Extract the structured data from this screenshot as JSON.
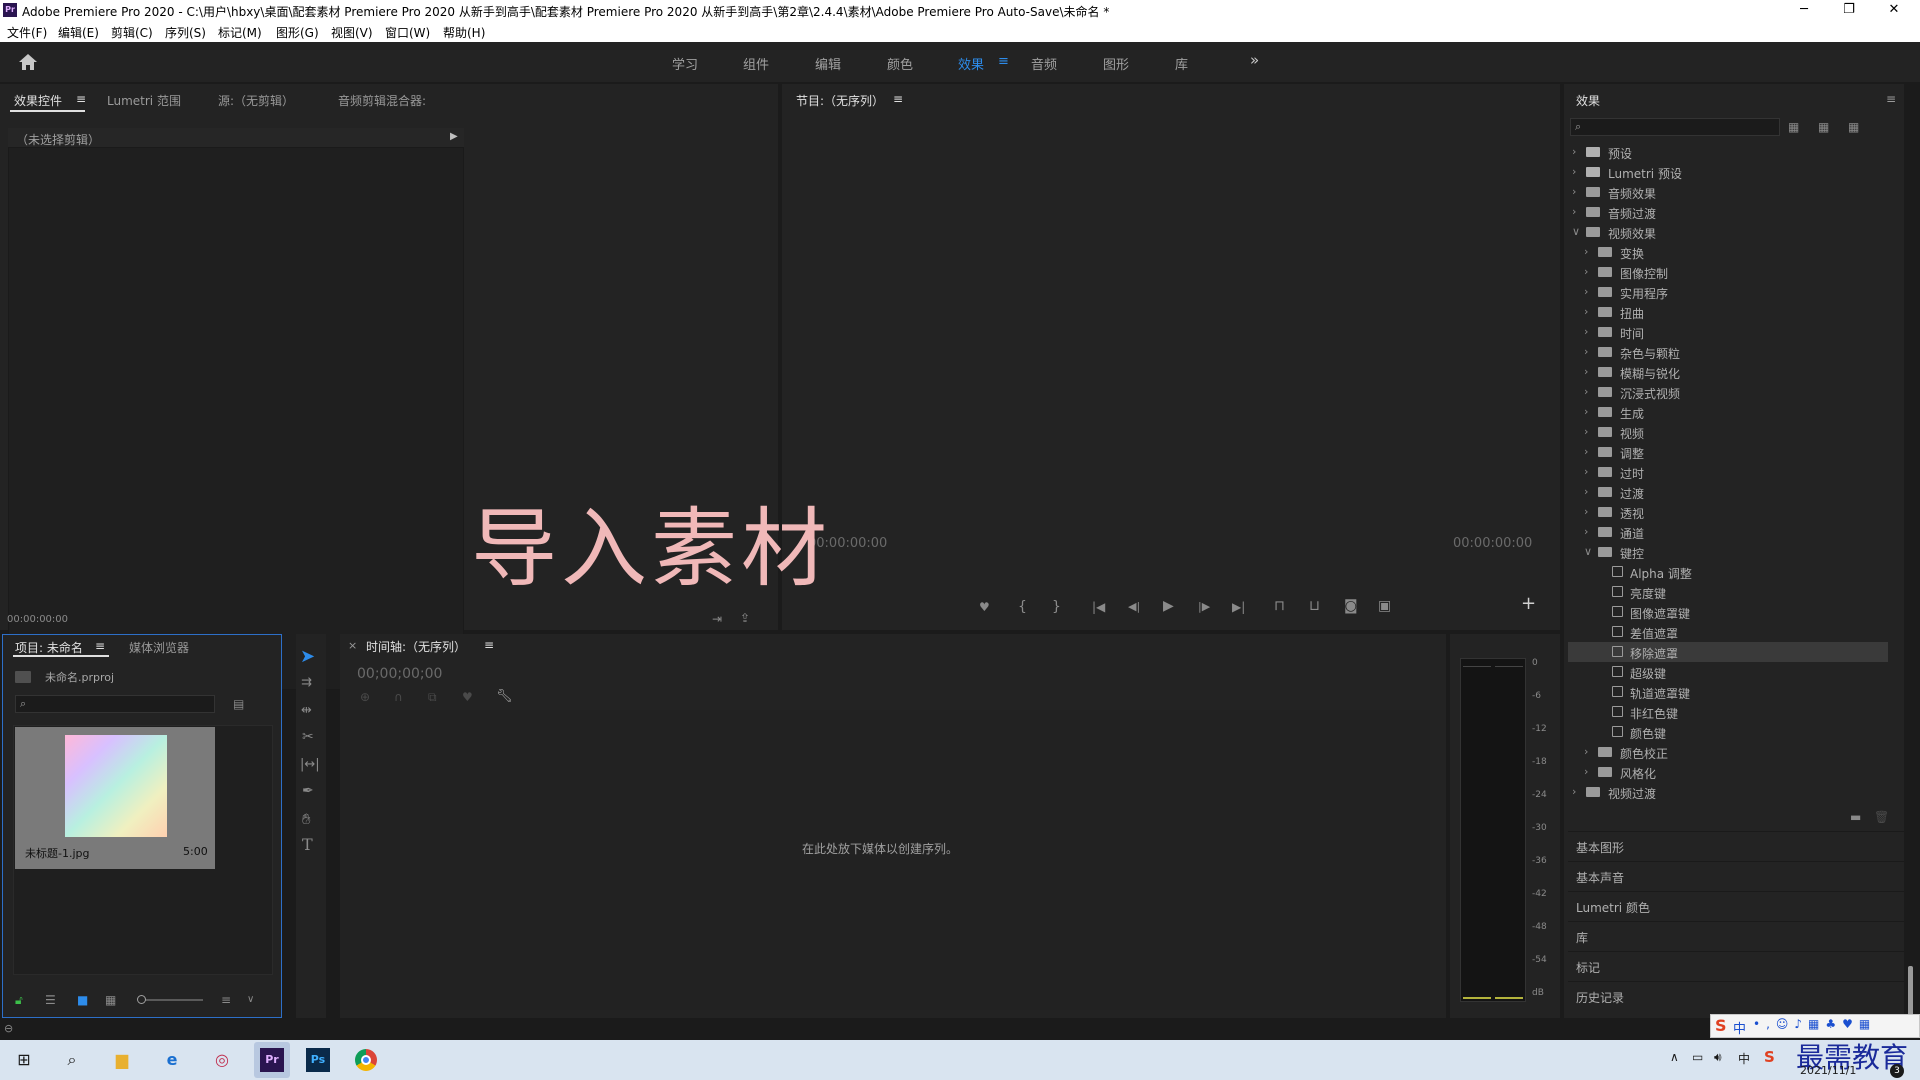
{
  "window": {
    "title": "Adobe Premiere Pro 2020 - C:\\用户\\hbxy\\桌面\\配套素材 Premiere Pro 2020 从新手到高手\\配套素材 Premiere Pro 2020 从新手到高手\\第2章\\2.4.4\\素材\\Adobe Premiere Pro Auto-Save\\未命名 *",
    "app_icon": "Pr",
    "controls": {
      "minimize": "─",
      "restore": "❐",
      "close": "✕"
    }
  },
  "menu": [
    "文件(F)",
    "编辑(E)",
    "剪辑(C)",
    "序列(S)",
    "标记(M)",
    "图形(G)",
    "视图(V)",
    "窗口(W)",
    "帮助(H)"
  ],
  "workspaces": {
    "items": [
      "学习",
      "组件",
      "编辑",
      "颜色",
      "效果",
      "音频",
      "图形",
      "库"
    ],
    "active": "效果",
    "more": "»"
  },
  "source_panel": {
    "tabs": [
      "效果控件",
      "Lumetri 范围",
      "源:（无剪辑）",
      "音频剪辑混合器:"
    ],
    "no_clip": "（未选择剪辑）",
    "timecode": "00:00:00:00"
  },
  "program_panel": {
    "title": "节目:（无序列）",
    "timecode_left": "00:00:00:00",
    "timecode_right": "00:00:00:00"
  },
  "overlay_caption": "导入素材",
  "project_panel": {
    "tabs": [
      "项目: 未命名",
      "媒体浏览器"
    ],
    "file": "未命名.prproj",
    "clip": {
      "name": "未标题-1.jpg",
      "duration": "5:00"
    }
  },
  "timeline_panel": {
    "title": "时间轴:（无序列）",
    "timecode": "00;00;00;00",
    "empty_text": "在此处放下媒体以创建序列。"
  },
  "audio_meter": {
    "scale": [
      "0",
      "-6",
      "-12",
      "-18",
      "-24",
      "-30",
      "-36",
      "-42",
      "-48",
      "-54",
      "dB"
    ]
  },
  "effects_panel": {
    "title": "效果",
    "tree": [
      {
        "label": "预设",
        "level": 0,
        "type": "folder-special",
        "open": false
      },
      {
        "label": "Lumetri 预设",
        "level": 0,
        "type": "folder-special",
        "open": false
      },
      {
        "label": "音频效果",
        "level": 0,
        "type": "folder",
        "open": false
      },
      {
        "label": "音频过渡",
        "level": 0,
        "type": "folder",
        "open": false
      },
      {
        "label": "视频效果",
        "level": 0,
        "type": "folder",
        "open": true
      },
      {
        "label": "变换",
        "level": 1,
        "type": "folder",
        "open": false
      },
      {
        "label": "图像控制",
        "level": 1,
        "type": "folder",
        "open": false
      },
      {
        "label": "实用程序",
        "level": 1,
        "type": "folder",
        "open": false
      },
      {
        "label": "扭曲",
        "level": 1,
        "type": "folder",
        "open": false
      },
      {
        "label": "时间",
        "level": 1,
        "type": "folder",
        "open": false
      },
      {
        "label": "杂色与颗粒",
        "level": 1,
        "type": "folder",
        "open": false
      },
      {
        "label": "模糊与锐化",
        "level": 1,
        "type": "folder",
        "open": false
      },
      {
        "label": "沉浸式视频",
        "level": 1,
        "type": "folder",
        "open": false
      },
      {
        "label": "生成",
        "level": 1,
        "type": "folder",
        "open": false
      },
      {
        "label": "视频",
        "level": 1,
        "type": "folder",
        "open": false
      },
      {
        "label": "调整",
        "level": 1,
        "type": "folder",
        "open": false
      },
      {
        "label": "过时",
        "level": 1,
        "type": "folder",
        "open": false
      },
      {
        "label": "过渡",
        "level": 1,
        "type": "folder",
        "open": false
      },
      {
        "label": "透视",
        "level": 1,
        "type": "folder",
        "open": false
      },
      {
        "label": "通道",
        "level": 1,
        "type": "folder",
        "open": false
      },
      {
        "label": "键控",
        "level": 1,
        "type": "folder",
        "open": true
      },
      {
        "label": "Alpha 调整",
        "level": 2,
        "type": "effect"
      },
      {
        "label": "亮度键",
        "level": 2,
        "type": "effect"
      },
      {
        "label": "图像遮罩键",
        "level": 2,
        "type": "effect"
      },
      {
        "label": "差值遮罩",
        "level": 2,
        "type": "effect"
      },
      {
        "label": "移除遮罩",
        "level": 2,
        "type": "effect",
        "selected": true
      },
      {
        "label": "超级键",
        "level": 2,
        "type": "effect"
      },
      {
        "label": "轨道遮罩键",
        "level": 2,
        "type": "effect"
      },
      {
        "label": "非红色键",
        "level": 2,
        "type": "effect"
      },
      {
        "label": "颜色键",
        "level": 2,
        "type": "effect"
      },
      {
        "label": "颜色校正",
        "level": 1,
        "type": "folder",
        "open": false
      },
      {
        "label": "风格化",
        "level": 1,
        "type": "folder",
        "open": false
      },
      {
        "label": "视频过渡",
        "level": 0,
        "type": "folder",
        "open": false
      }
    ],
    "sections": [
      "基本图形",
      "基本声音",
      "Lumetri 颜色",
      "库",
      "标记",
      "历史记录"
    ]
  },
  "taskbar": {
    "ime": "中",
    "date": "2021/11/1",
    "watermark": "最需教育",
    "notif_count": "3"
  }
}
